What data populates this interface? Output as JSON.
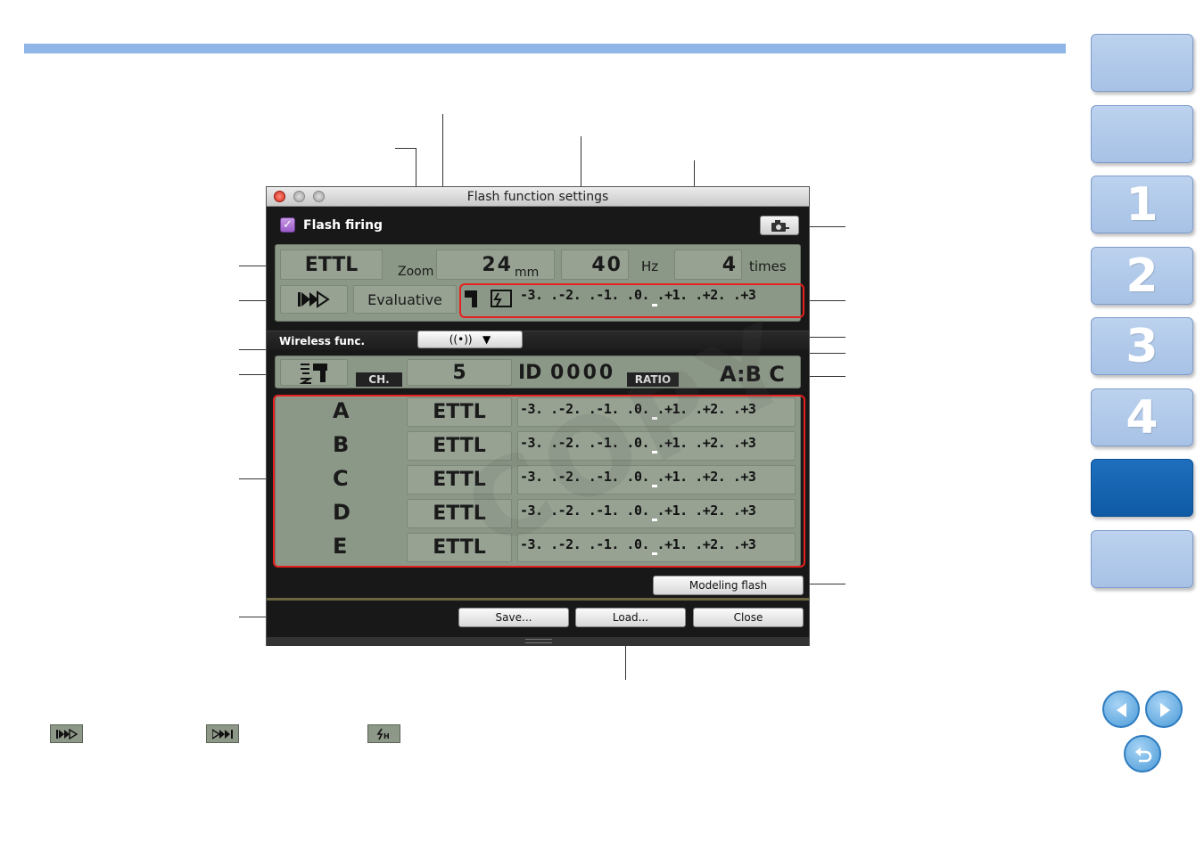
{
  "window": {
    "title": "Flash function settings",
    "flash_firing_label": "Flash firing",
    "flash_firing_checked": true
  },
  "main_panel": {
    "mode": "ETTL",
    "zoom_label": "Zoom",
    "zoom_value": "24",
    "zoom_unit": "mm",
    "freq_value": "40",
    "freq_unit": "Hz",
    "times_value": "4",
    "times_unit": "times",
    "metering": "Evaluative",
    "comp_scale": "-3. .-2. .-1. .0. .+1. .+2. .+3"
  },
  "wireless": {
    "label": "Wireless func.",
    "channel_label": "CH.",
    "channel_value": "5",
    "id_label": "ID",
    "id_value": "0000",
    "ratio_label": "RATIO",
    "ratio_value": "A:B C"
  },
  "groups": [
    {
      "name": "A",
      "mode": "ETTL",
      "scale": "-3. .-2. .-1. .0. .+1. .+2. .+3"
    },
    {
      "name": "B",
      "mode": "ETTL",
      "scale": "-3. .-2. .-1. .0. .+1. .+2. .+3"
    },
    {
      "name": "C",
      "mode": "ETTL",
      "scale": "-3. .-2. .-1. .0. .+1. .+2. .+3"
    },
    {
      "name": "D",
      "mode": "ETTL",
      "scale": "-3. .-2. .-1. .0. .+1. .+2. .+3"
    },
    {
      "name": "E",
      "mode": "ETTL",
      "scale": "-3. .-2. .-1. .0. .+1. .+2. .+3"
    }
  ],
  "buttons": {
    "modeling_flash": "Modeling flash",
    "save": "Save...",
    "load": "Load...",
    "close": "Close"
  },
  "side_tabs": [
    "",
    "",
    "1",
    "2",
    "3",
    "4",
    "",
    ""
  ],
  "active_tab_index": 5,
  "watermark": "COPY",
  "colors": {
    "accent": "#8fb6e6",
    "tab": "#a7c2e6",
    "tab_active": "#1565b3",
    "highlight": "#e62020"
  }
}
